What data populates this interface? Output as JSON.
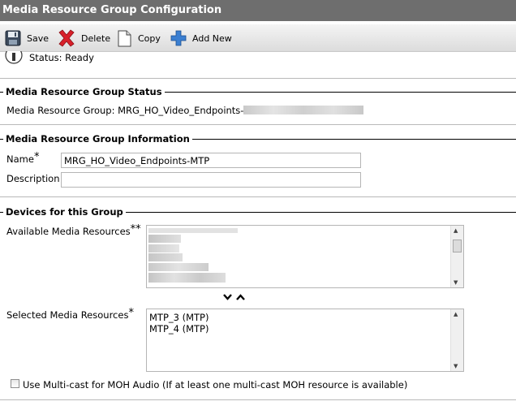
{
  "header": {
    "title": "Media Resource Group Configuration"
  },
  "toolbar": {
    "save_label": "Save",
    "delete_label": "Delete",
    "copy_label": "Copy",
    "add_new_label": "Add New"
  },
  "status": {
    "text": "Status: Ready"
  },
  "status_section": {
    "title": "Media Resource Group Status",
    "group_text": "Media Resource Group: MRG_HO_Video_Endpoints-MTP"
  },
  "info_section": {
    "title": "Media Resource Group Information",
    "name_label": "Name",
    "name_value": "MRG_HO_Video_Endpoints-MTP",
    "description_label": "Description",
    "description_value": ""
  },
  "devices_section": {
    "title": "Devices for this Group",
    "available_label": "Available Media Resources",
    "selected_label": "Selected Media Resources",
    "selected_items": [
      "MTP_3 (MTP)",
      "MTP_4 (MTP)"
    ],
    "required_marker": "*",
    "multicast_label": "Use Multi-cast for MOH Audio (If at least one multi-cast MOH resource is available)",
    "multicast_checked": false
  },
  "colors": {
    "title_bg": "#6e6e6e",
    "delete_red": "#d8202a",
    "add_blue": "#3b7fd1"
  }
}
